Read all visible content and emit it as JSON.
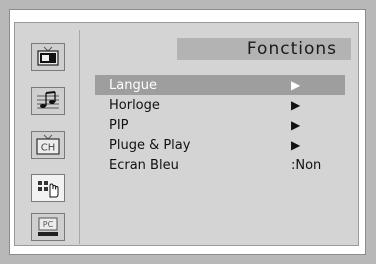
{
  "title": "Fonctions",
  "menu": {
    "items": [
      {
        "label": "Langue",
        "value": "▶"
      },
      {
        "label": "Horloge",
        "value": "▶"
      },
      {
        "label": "PIP",
        "value": "▶"
      },
      {
        "label": "Pluge & Play",
        "value": "▶"
      },
      {
        "label": "Ecran Bleu",
        "value": ":Non"
      }
    ]
  },
  "sidebar": {
    "icons": [
      {
        "name": "tv-picture-icon"
      },
      {
        "name": "sound-notes-icon"
      },
      {
        "name": "channel-icon",
        "label": "CH"
      },
      {
        "name": "setup-hand-icon"
      },
      {
        "name": "pc-icon",
        "label": "PC"
      }
    ]
  },
  "colors": {
    "background": "#b8b8b8",
    "panel": "#d4d4d4",
    "title_bar": "#b3b3b3",
    "selected_row": "#9e9e9e"
  }
}
